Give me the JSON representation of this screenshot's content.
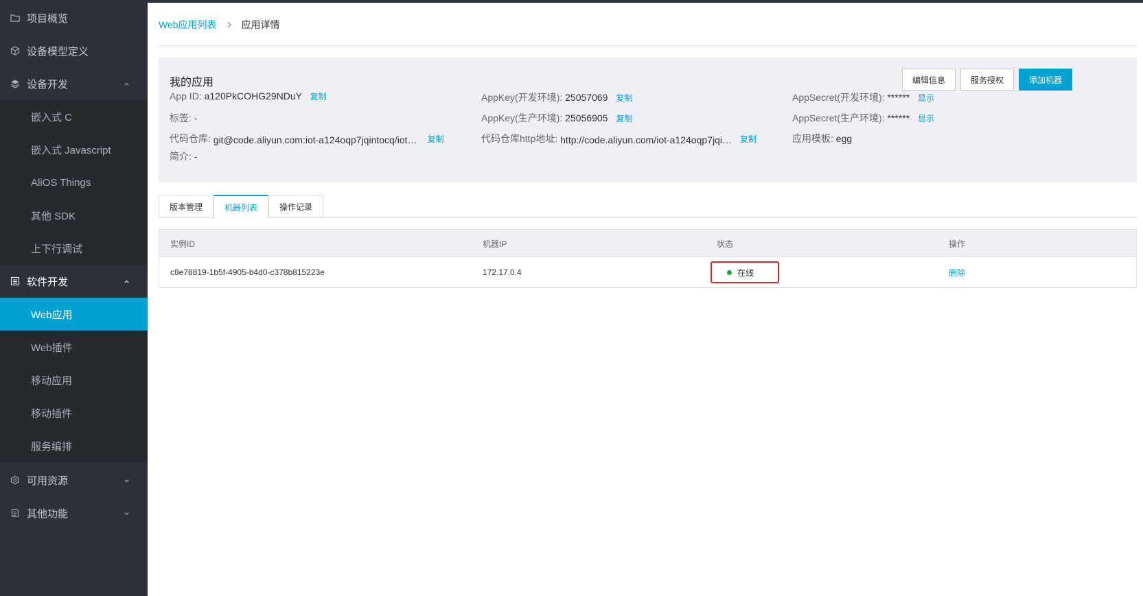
{
  "sidebar": {
    "items": [
      {
        "label": "项目概览",
        "icon": "folder-icon"
      },
      {
        "label": "设备模型定义",
        "icon": "cube-icon"
      },
      {
        "label": "设备开发",
        "icon": "layers-icon",
        "expanded": true
      },
      {
        "label": "嵌入式 C"
      },
      {
        "label": "嵌入式 Javascript"
      },
      {
        "label": "AliOS Things"
      },
      {
        "label": "其他 SDK"
      },
      {
        "label": "上下行调试"
      },
      {
        "label": "软件开发",
        "icon": "list-icon",
        "expanded": true
      },
      {
        "label": "Web应用",
        "active": true
      },
      {
        "label": "Web插件"
      },
      {
        "label": "移动应用"
      },
      {
        "label": "移动插件"
      },
      {
        "label": "服务编排"
      },
      {
        "label": "可用资源",
        "icon": "resource-icon",
        "expanded": false
      },
      {
        "label": "其他功能",
        "icon": "doc-icon",
        "expanded": false
      }
    ]
  },
  "breadcrumb": {
    "parent": "Web应用列表",
    "current": "应用详情"
  },
  "app": {
    "title": "我的应用",
    "buttons": {
      "edit": "编辑信息",
      "auth": "服务授权",
      "add": "添加机器"
    },
    "app_id_label": "App ID:",
    "app_id_value": "a120PkCOHG29NDuY",
    "tag_label": "标签:",
    "tag_value": "-",
    "repo_label": "代码仓库:",
    "repo_value": "git@code.aliyun.com:iot-a124oqp7jqintocq/iot-a1...",
    "desc_label": "简介:",
    "desc_value": "-",
    "appkey_dev_label": "AppKey(开发环境):",
    "appkey_dev_value": "25057069",
    "appkey_prod_label": "AppKey(生产环境):",
    "appkey_prod_value": "25056905",
    "repo_http_label": "代码仓库http地址:",
    "repo_http_value": "http://code.aliyun.com/iot-a124oqp7jqint...",
    "secret_dev_label": "AppSecret(开发环境):",
    "secret_dev_value": "******",
    "secret_prod_label": "AppSecret(生产环境):",
    "secret_prod_value": "******",
    "template_label": "应用模板:",
    "template_value": "egg",
    "copy": "复制",
    "show": "显示"
  },
  "tabs": [
    {
      "label": "版本管理"
    },
    {
      "label": "机器列表",
      "active": true
    },
    {
      "label": "操作记录"
    }
  ],
  "table": {
    "headers": [
      "实例ID",
      "机器IP",
      "状态",
      "操作"
    ],
    "rows": [
      {
        "instance_id": "c8e78819-1b5f-4905-b4d0-c378b815223e",
        "ip": "172.17.0.4",
        "status": "在线",
        "action": "删除"
      }
    ],
    "status_color": "#22a33a",
    "highlight_color": "#d9252b"
  },
  "colors": {
    "accent": "#00a2d1",
    "sidebar_bg": "#2c3137"
  }
}
